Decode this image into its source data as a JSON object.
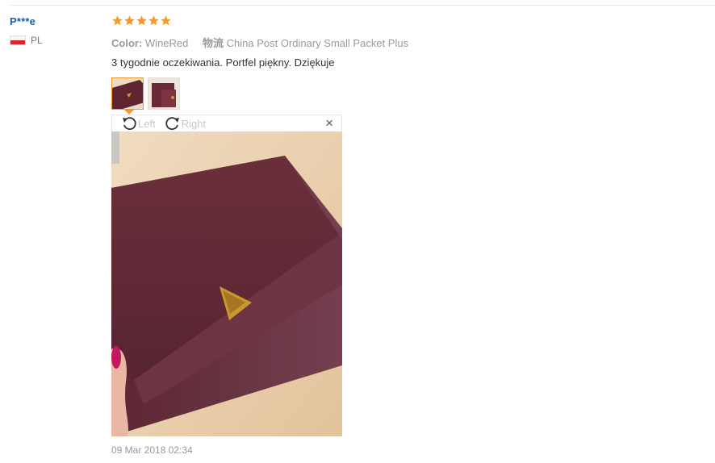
{
  "review": {
    "username": "P***e",
    "country_code": "PL",
    "rating": 5,
    "attributes": [
      {
        "key": "Color:",
        "value": "WineRed"
      },
      {
        "key": "物流",
        "value": "China Post Ordinary Small Packet Plus"
      }
    ],
    "text": "3 tygodnie oczekiwania. Portfel piękny. Dziękuje",
    "date": "09 Mar 2018 02:34"
  },
  "viewer": {
    "rotate_left_label": "Left",
    "rotate_right_label": "Right",
    "close_symbol": "×"
  },
  "colors": {
    "username": "#1a5fa8",
    "star": "#f29a2e",
    "active_border": "#f29a2e",
    "wallet": "#5e2530"
  }
}
